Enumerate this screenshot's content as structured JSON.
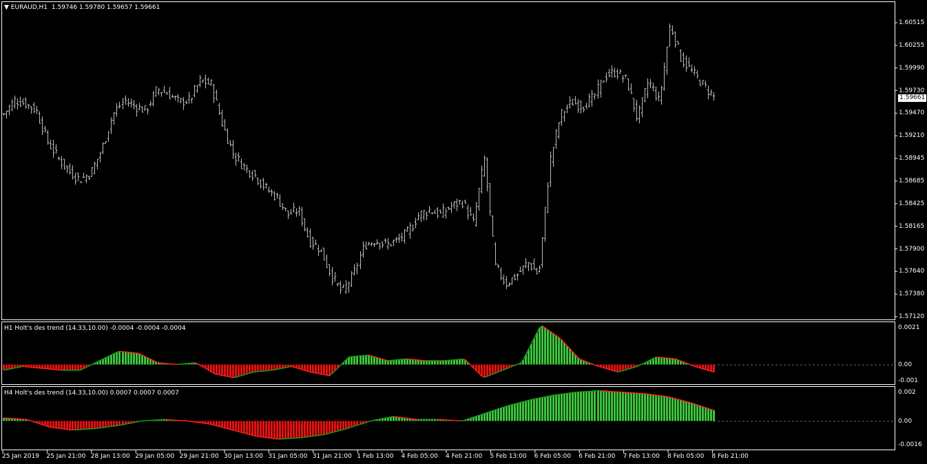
{
  "main_panel": {
    "symbol": "EURAUD,H1",
    "ohlc": "1.59746 1.59780 1.59657 1.59661",
    "current_price": "1.59661",
    "y_ticks": [
      "1.60515",
      "1.60255",
      "1.59990",
      "1.59730",
      "1.59470",
      "1.59210",
      "1.58945",
      "1.58685",
      "1.58425",
      "1.58165",
      "1.57900",
      "1.57640",
      "1.57380",
      "1.57120"
    ]
  },
  "indicator1": {
    "title": "H1 Holt's des trend (14.33,10.00) -0.0004 -0.0004 -0.0004",
    "y_ticks": [
      "0.0021",
      "0.00",
      "-0.001"
    ]
  },
  "indicator2": {
    "title": "H4 Holt's des trend (14.33,10.00) 0.0007 0.0007 0.0007",
    "y_ticks": [
      "0.002",
      "0.00",
      "-0.0016"
    ]
  },
  "time_axis": [
    "25 Jan 2019",
    "25 Jan 21:00",
    "28 Jan 13:00",
    "29 Jan 05:00",
    "29 Jan 21:00",
    "30 Jan 13:00",
    "31 Jan 05:00",
    "31 Jan 21:00",
    "1 Feb 13:00",
    "4 Feb 05:00",
    "4 Feb 21:00",
    "5 Feb 13:00",
    "6 Feb 05:00",
    "6 Feb 21:00",
    "7 Feb 13:00",
    "8 Feb 05:00",
    "8 Feb 21:00"
  ],
  "colors": {
    "background": "#000000",
    "bars": "#bdbdbd",
    "positive": "#3cc43c",
    "negative": "#e81010",
    "frame": "#ffffff",
    "zero_line": "#7a5a8a"
  },
  "chart_data": {
    "type": "bar",
    "price_close_anchors": [
      1.5946,
      1.5962,
      1.5958,
      1.595,
      1.5915,
      1.5895,
      1.588,
      1.587,
      1.5878,
      1.5905,
      1.5945,
      1.5962,
      1.5955,
      1.595,
      1.5975,
      1.597,
      1.596,
      1.5962,
      1.5985,
      1.598,
      1.5935,
      1.59,
      1.5885,
      1.5875,
      1.586,
      1.585,
      1.583,
      1.5835,
      1.58,
      1.579,
      1.576,
      1.574,
      1.576,
      1.5795,
      1.58,
      1.5795,
      1.58,
      1.581,
      1.583,
      1.5835,
      1.583,
      1.584,
      1.5845,
      1.582,
      1.5895,
      1.577,
      1.575,
      1.576,
      1.5775,
      1.576,
      1.589,
      1.5945,
      1.596,
      1.5955,
      1.5965,
      1.599,
      1.5995,
      1.5985,
      1.594,
      1.5985,
      1.596,
      1.605,
      1.601,
      1.5995,
      1.598,
      1.5966
    ],
    "h1_anchors": [
      -0.0003,
      -0.0001,
      -0.0002,
      -0.0003,
      -0.0003,
      0.0002,
      0.0007,
      0.0006,
      0.0001,
      0,
      0.0001,
      -0.0005,
      -0.0007,
      -0.0004,
      -0.0003,
      -0.0001,
      -0.0004,
      -0.0006,
      0.0004,
      0.0005,
      0.0002,
      0.0003,
      0.0002,
      0.0002,
      0.0003,
      -0.0007,
      -0.0003,
      0.0001,
      0.0021,
      0.0014,
      0.0003,
      -0.0001,
      -0.0004,
      -0.0001,
      0.0004,
      0.0003,
      -0.0001,
      -0.0004
    ],
    "h4_anchors": [
      0.0002,
      0.0001,
      -0.0004,
      -0.0006,
      -0.0005,
      -0.0003,
      0,
      0.0001,
      0,
      -0.0002,
      -0.0006,
      -0.001,
      -0.0012,
      -0.0011,
      -0.0009,
      -0.0005,
      0,
      0.0003,
      0.0001,
      0.0001,
      0,
      0.0005,
      0.001,
      0.0014,
      0.0017,
      0.0019,
      0.002,
      0.0019,
      0.0018,
      0.0016,
      0.0012,
      0.0007
    ]
  }
}
